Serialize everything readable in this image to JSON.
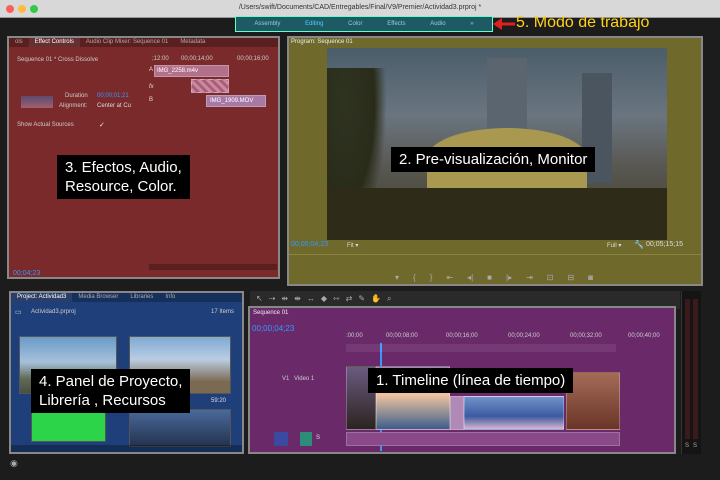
{
  "window": {
    "title": "/Users/swift/Documents/CAD/Entregables/Final/V9/Premier/Actividad3.prproj *"
  },
  "workspace": {
    "tabs": [
      {
        "label": "Assembly"
      },
      {
        "label": "Editing"
      },
      {
        "label": "Color"
      },
      {
        "label": "Effects"
      },
      {
        "label": "Audio"
      }
    ],
    "more": "»",
    "annotation": "5. Modo de trabajo",
    "arrow_color": "#e02020"
  },
  "effects_panel": {
    "tabs": [
      "ols",
      "Effect Controls",
      "Audio Clip Mixer: Sequence 01",
      "Metadata"
    ],
    "sequence_label": "Sequence 01 * Cross Dissolve",
    "time_start": ";12:00",
    "time_mid": "00;00;14;00",
    "time_end": "00;00;16;00",
    "clip_a": "IMG_2258.m4v",
    "clip_b": "IMG_1909.MOV",
    "marker_a": "A",
    "marker_b": "B",
    "fx": "fx",
    "duration_label": "Duration",
    "duration_value": "00;00;01;21",
    "alignment_label": "Alignment:",
    "alignment_value": "Center at Cu",
    "show_sources": "Show Actual Sources",
    "timecode": "00;04;23",
    "annotation": "3. Efectos, Audio,\nResource, Color.",
    "color": "#7a2a2a"
  },
  "program_monitor": {
    "title": "Program: Sequence 01",
    "timecode": "00;00;04;23",
    "fit": "Fit",
    "quality": "Full",
    "duration": "00;05;15;15",
    "annotation": "2. Pre-visualización, Monitor",
    "color": "#6f6a2c"
  },
  "project_panel": {
    "tabs": [
      "Project: Actividad3",
      "Media Browser",
      "Libraries",
      "Info"
    ],
    "file": "Actividad3.prproj",
    "count": "17 Items",
    "thumb_duration": "59:20",
    "annotation": "4. Panel de Proyecto,\nLibrería , Recursos",
    "color": "#1f3f7a"
  },
  "timeline": {
    "tab": "Sequence 01",
    "timecode": "00;00;04;23",
    "ruler": [
      ":00;00",
      "00;00;08;00",
      "00;00;16;00",
      "00;00;24;00",
      "00;00;32;00",
      "00;00;40;00"
    ],
    "video_track": "V1",
    "video_track_name": "Video 1",
    "audio_track": "S",
    "meter_labels": [
      "S",
      "S"
    ],
    "annotation": "1. Timeline (línea de tiempo)",
    "color": "#6a2a6a"
  }
}
